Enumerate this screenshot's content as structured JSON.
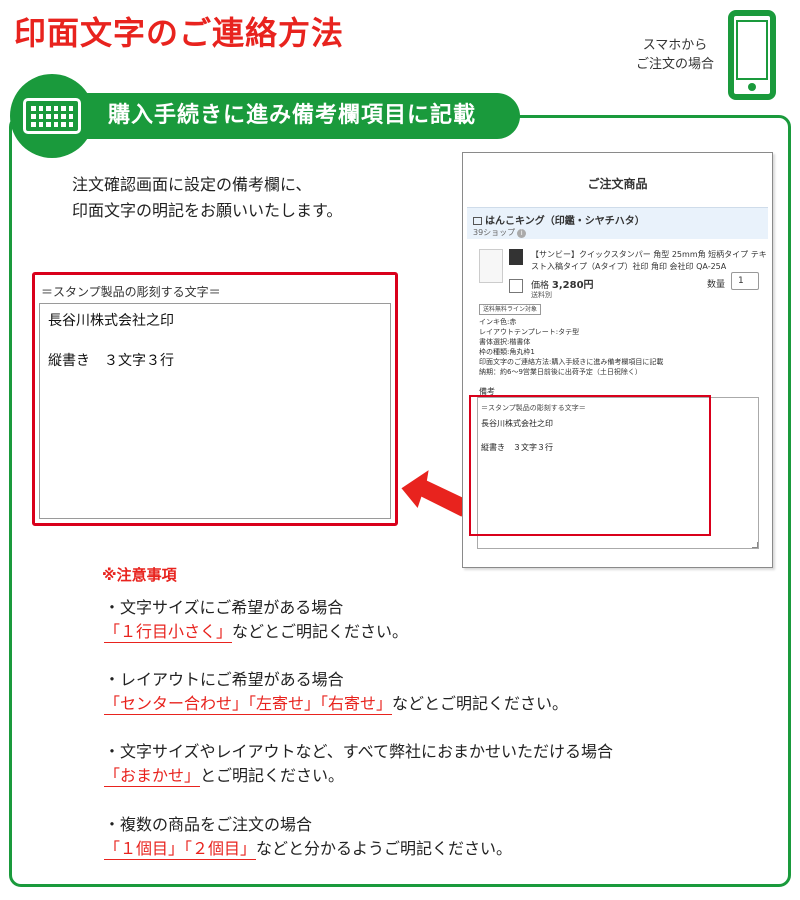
{
  "title": "印面文字のご連絡方法",
  "smartphone_note": {
    "line1": "スマホから",
    "line2": "ご注文の場合"
  },
  "step": {
    "title": "購入手続きに進み備考欄項目に記載"
  },
  "intro": {
    "line1": "注文確認画面に設定の備考欄に、",
    "line2": "印面文字の明記をお願いいたします。"
  },
  "example_box": {
    "heading": "＝スタンプ製品の彫刻する文字＝",
    "line1": "長谷川株式会社之印",
    "line2": "縦書き　３文字３行"
  },
  "screenshot": {
    "title": "ご注文商品",
    "shop_name": "はんこキング（印鑑・シヤチハタ）",
    "shop_sub": "39ショップ",
    "product_name": "【サンビー】クイックスタンパー 角型 25mm角 短柄タイプ テキスト入稿タイプ（Aタイプ）社印 角印 会社印 QA-25A",
    "price_label": "価格",
    "price": "3,280円",
    "shipping": "送料別",
    "qty_label": "数量",
    "qty": "1",
    "tag": "送料無料ライン対象",
    "options": [
      "インキ色:赤",
      "レイアウトテンプレート:タテ型",
      "書体選択:楷書体",
      "枠の種類:角丸枠1",
      "印面文字のご連絡方法:購入手続きに進み備考欄項目に記載",
      "納期：約6〜9営業日前後に出荷予定（土日祝除く）"
    ],
    "memo_label": "備考",
    "memo_heading": "＝スタンプ製品の彫刻する文字＝",
    "memo_line1": "長谷川株式会社之印",
    "memo_line2": "縦書き　３文字３行"
  },
  "caution": {
    "title": "※注意事項",
    "items": [
      {
        "q": "・文字サイズにご希望がある場合",
        "highlights": [
          "「１行目小さく」"
        ],
        "suffix": "などとご明記ください。"
      },
      {
        "q": "・レイアウトにご希望がある場合",
        "highlights": [
          "「センター合わせ」「左寄せ」「右寄せ」"
        ],
        "suffix": "などとご明記ください。"
      },
      {
        "q": "・文字サイズやレイアウトなど、すべて弊社におまかせいただける場合",
        "highlights": [
          "「おまかせ」"
        ],
        "suffix": "とご明記ください。"
      },
      {
        "q": "・複数の商品をご注文の場合",
        "highlights": [
          "「１個目」「２個目」"
        ],
        "suffix": "などと分かるようご明記ください。"
      }
    ]
  },
  "colors": {
    "accent_green": "#1a9a3c",
    "accent_red": "#e8231e",
    "highlight_red": "#d9001b"
  },
  "icons": [
    "keyboard-icon",
    "smartphone-icon",
    "arrow-left-icon",
    "shop-bag-icon",
    "info-icon"
  ]
}
